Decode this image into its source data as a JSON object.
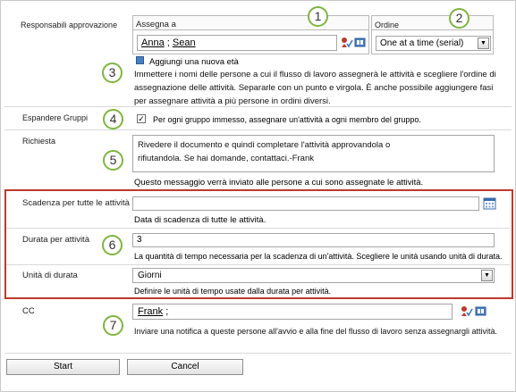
{
  "approvers": {
    "label": "Responsabili  approvazione",
    "assign_to_header": "Assegna a",
    "order_header": "Ordine",
    "people_1": "Anna",
    "people_sep": ";",
    "people_2": "Sean",
    "order_value": "One at a time (serial)",
    "add_stage_link": "Aggiungi una nuova età",
    "description": "Immettere i nomi delle persone a cui il flusso di lavoro assegnerà le attività e scegliere l'ordine di assegnazione delle attività. Separarle con un punto e virgola. È anche possibile aggiungere fasi per assegnare attività a più persone in ordini diversi."
  },
  "expand_groups": {
    "label": "Espandere Gruppi",
    "checkbox_text": "Per ogni gruppo immesso, assegnare un'attività a ogni membro del gruppo.",
    "checked": true
  },
  "request": {
    "label": "Richiesta",
    "text": "Rivedere il documento e quindi completare l'attività approvandola o rifiutandola. Se hai domande, contattaci.-Frank",
    "hint": "Questo messaggio verrà inviato alle persone a cui sono assegnate le attività."
  },
  "due_date": {
    "label": "Scadenza per tutte le attività",
    "hint": "Data di scadenza di tutte le attività."
  },
  "duration": {
    "label": "Durata per attività",
    "value": "3",
    "hint": "La quantità di tempo necessaria per la scadenza di un'attività. Scegliere le unità usando unità di durata."
  },
  "duration_units": {
    "label": "Unità di durata",
    "value": "Giorni",
    "hint": "Definire le unità di tempo usate dalla durata per attività."
  },
  "cc": {
    "label": "CC",
    "people": "Frank",
    "sep": ";",
    "hint": "Inviare una notifica a queste persone all'avvio e alla fine del flusso di lavoro senza assegnargli attività."
  },
  "buttons": {
    "start": "Start",
    "cancel": "Cancel"
  },
  "callouts": [
    "1",
    "2",
    "3",
    "4",
    "5",
    "6",
    "7"
  ],
  "colors": {
    "callout_border": "#7fb640",
    "highlight_box": "#c0392b"
  }
}
